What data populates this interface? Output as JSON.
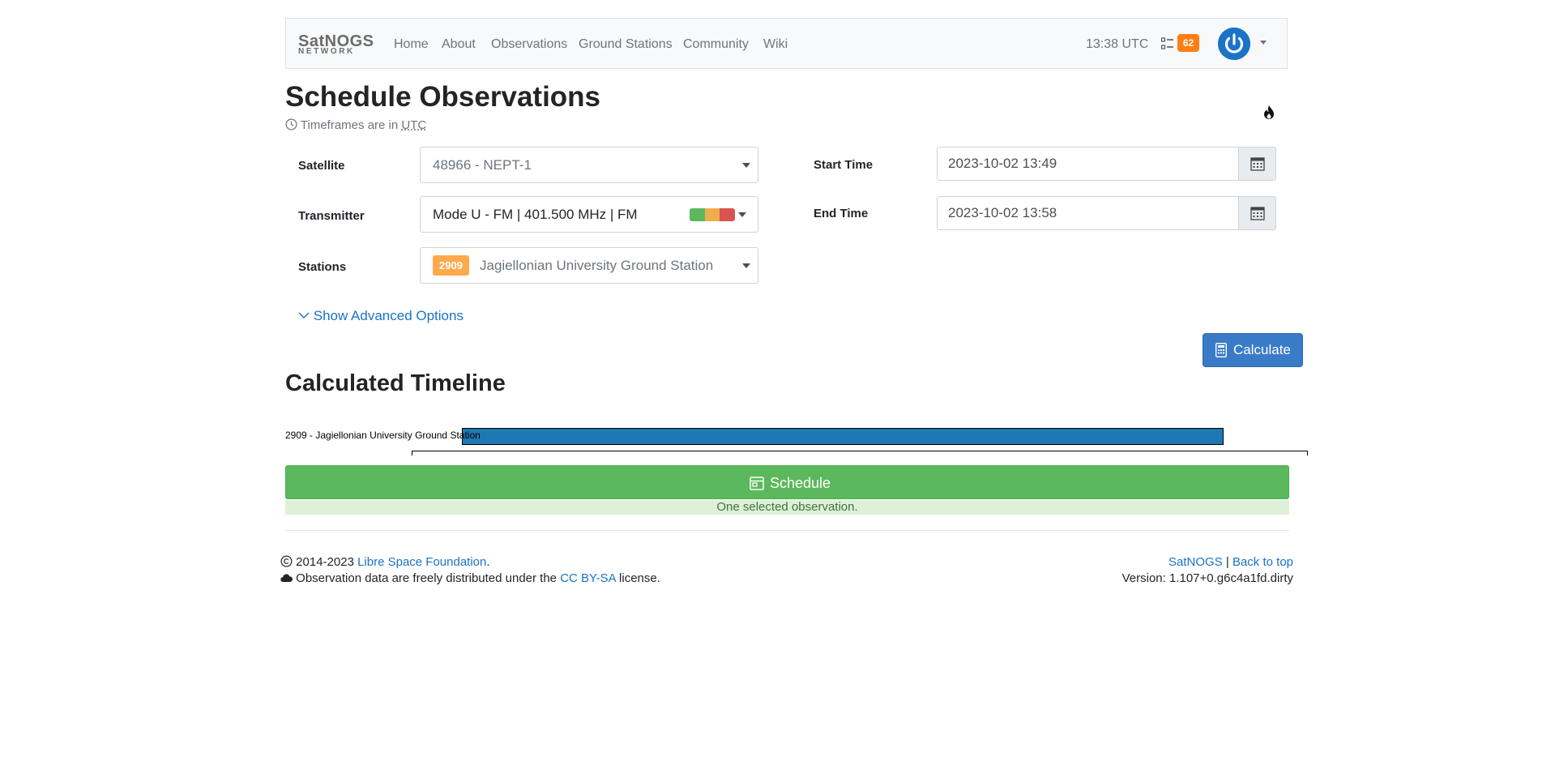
{
  "navbar": {
    "brand_top": "SatNOGS",
    "brand_bottom": "NETWORK",
    "links": [
      "Home",
      "About",
      "Observations",
      "Ground Stations",
      "Community",
      "Wiki"
    ],
    "time": "13:38 UTC",
    "tasks_count": "62",
    "icons": [
      "tasks-icon",
      "power-icon",
      "caret-down-icon"
    ]
  },
  "page": {
    "title": "Schedule Observations",
    "tz_prefix": "Timeframes are in",
    "tz_abbr": "UTC"
  },
  "form": {
    "satellite_label": "Satellite",
    "satellite_value": "48966 - NEPT-1",
    "transmitter_label": "Transmitter",
    "transmitter_value": "Mode U - FM | 401.500 MHz | FM",
    "stations_label": "Stations",
    "station_id": "2909",
    "station_name": "Jagiellonian University Ground Station",
    "start_label": "Start Time",
    "start_value": "2023-10-02 13:49",
    "end_label": "End Time",
    "end_value": "2023-10-02 13:58",
    "advanced_label": "Show Advanced Options",
    "calculate_label": "Calculate",
    "quality_colors": [
      "#5cb85c",
      "#f0ad4e",
      "#d9534f"
    ]
  },
  "timeline": {
    "title": "Calculated Timeline",
    "row_label": "2909 - Jagiellonian University Ground Station",
    "bar_color": "#1f77b4",
    "schedule_label": "Schedule",
    "selected_note": "One selected observation."
  },
  "footer": {
    "copyright": "2014-2023",
    "org_link": "Libre Space Foundation",
    "period": ".",
    "license_prefix": "Observation data are freely distributed under the",
    "license_link": "CC BY-SA",
    "license_suffix": "license.",
    "satnogs_link": "SatNOGS",
    "separator": "|",
    "back_to_top": "Back to top",
    "version": "Version: 1.107+0.g6c4a1fd.dirty"
  },
  "colors": {
    "accent": "#1a73c7",
    "schedule_green": "#5cb85c",
    "badge_orange": "#fd7e14",
    "station_badge": "#ffa94d"
  }
}
